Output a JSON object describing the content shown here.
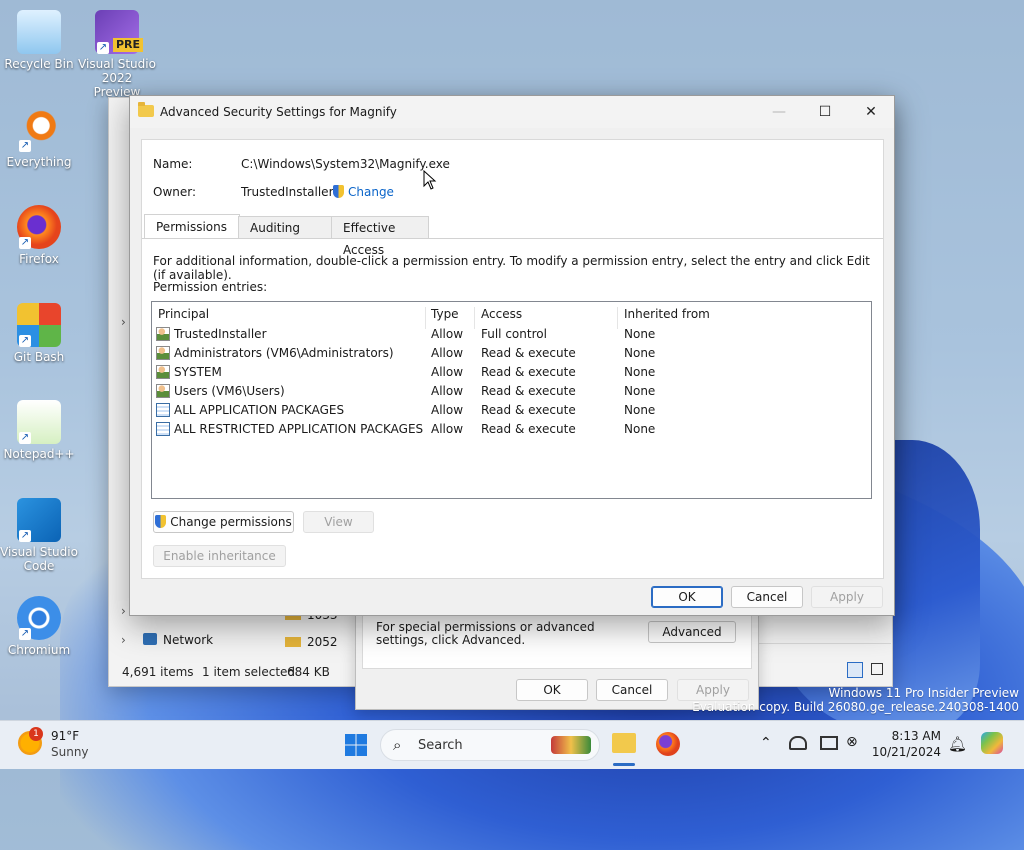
{
  "desktop": {
    "icons": [
      {
        "label_lines": [
          "Recycle Bin"
        ],
        "icon": "recycle-bin-icon",
        "shortcut": false
      },
      {
        "label_lines": [
          "Visual Studio",
          "2022 Preview"
        ],
        "icon": "visual-studio-preview-icon",
        "badge": "PRE",
        "shortcut": true
      },
      {
        "label_lines": [
          "Everything"
        ],
        "icon": "everything-search-icon",
        "shortcut": true
      },
      {
        "label_lines": [
          "Firefox"
        ],
        "icon": "firefox-icon",
        "shortcut": true
      },
      {
        "label_lines": [
          "Git Bash"
        ],
        "icon": "git-bash-icon",
        "shortcut": true
      },
      {
        "label_lines": [
          "Notepad++"
        ],
        "icon": "notepad-plus-plus-icon",
        "shortcut": true
      },
      {
        "label_lines": [
          "Visual Studio",
          "Code"
        ],
        "icon": "vscode-icon",
        "shortcut": true
      },
      {
        "label_lines": [
          "Chromium"
        ],
        "icon": "chromium-icon",
        "shortcut": true
      }
    ],
    "watermark": {
      "line1": "Windows 11 Pro Insider Preview",
      "line2": "Evaluation copy. Build 26080.ge_release.240308-1400"
    }
  },
  "explorer": {
    "nav_network": "Network",
    "status_items": "4,691 items",
    "status_selected": "1 item selected",
    "status_size": "684 KB",
    "folders": [
      "1033",
      "2052"
    ]
  },
  "properties_dialog": {
    "special_text": "For special permissions or advanced settings, click Advanced.",
    "advanced_button": "Advanced",
    "ok": "OK",
    "cancel": "Cancel",
    "apply": "Apply"
  },
  "dialog": {
    "title": "Advanced Security Settings for Magnify",
    "name_label": "Name:",
    "name_value": "C:\\Windows\\System32\\Magnify.exe",
    "owner_label": "Owner:",
    "owner_value": "TrustedInstaller",
    "owner_change": "Change",
    "tabs": [
      "Permissions",
      "Auditing",
      "Effective Access"
    ],
    "info_text": "For additional information, double-click a permission entry. To modify a permission entry, select the entry and click Edit (if available).",
    "entries_label": "Permission entries:",
    "columns": [
      "Principal",
      "Type",
      "Access",
      "Inherited from"
    ],
    "rows": [
      {
        "principal": "TrustedInstaller",
        "type": "Allow",
        "access": "Full control",
        "inherited": "None",
        "icon": "user-group-icon"
      },
      {
        "principal": "Administrators (VM6\\Administrators)",
        "type": "Allow",
        "access": "Read & execute",
        "inherited": "None",
        "icon": "user-group-icon"
      },
      {
        "principal": "SYSTEM",
        "type": "Allow",
        "access": "Read & execute",
        "inherited": "None",
        "icon": "user-group-icon"
      },
      {
        "principal": "Users (VM6\\Users)",
        "type": "Allow",
        "access": "Read & execute",
        "inherited": "None",
        "icon": "user-group-icon"
      },
      {
        "principal": "ALL APPLICATION PACKAGES",
        "type": "Allow",
        "access": "Read & execute",
        "inherited": "None",
        "icon": "app-package-icon"
      },
      {
        "principal": "ALL RESTRICTED APPLICATION PACKAGES",
        "type": "Allow",
        "access": "Read & execute",
        "inherited": "None",
        "icon": "app-package-icon"
      }
    ],
    "change_permissions": "Change permissions",
    "view": "View",
    "enable_inheritance": "Enable inheritance",
    "ok": "OK",
    "cancel": "Cancel",
    "apply": "Apply"
  },
  "taskbar": {
    "weather_temp": "91°F",
    "weather_desc": "Sunny",
    "weather_badge": "1",
    "search_placeholder": "Search",
    "time": "8:13 AM",
    "date": "10/21/2024"
  }
}
